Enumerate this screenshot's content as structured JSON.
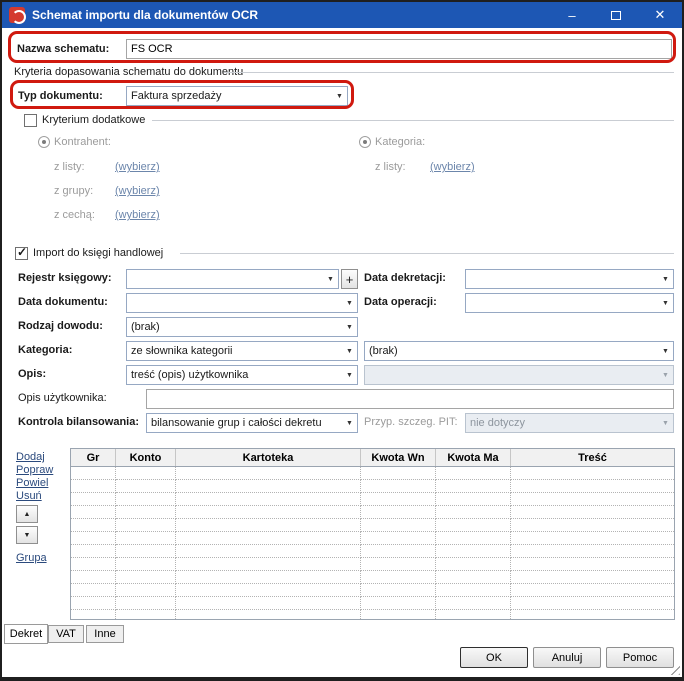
{
  "colors": {
    "titlebar": "#1d57b4",
    "annotation": "#d0190f",
    "link": "#2b4a7d"
  },
  "window": {
    "title": "Schemat importu dla dokumentów OCR",
    "minimize": "–",
    "close": "✕"
  },
  "schema": {
    "label": "Nazwa schematu:",
    "value": "FS OCR"
  },
  "criteria": {
    "title": "Kryteria dopasowania schematu do dokumentu",
    "doc_type_label": "Typ dokumentu:",
    "doc_type_value": "Faktura sprzedaży",
    "additional_label": "Kryterium dodatkowe",
    "kontrahent_label": "Kontrahent:",
    "kategoria_label": "Kategoria:",
    "z_listy": "z listy:",
    "z_grupy": "z grupy:",
    "z_cecha": "z cechą:",
    "wybierz": "(wybierz)"
  },
  "import": {
    "label": "Import do księgi handlowej",
    "rejestr_label": "Rejestr księgowy:",
    "rejestr_value": "",
    "add_button": "+",
    "data_dekretacji_label": "Data dekretacji:",
    "data_dekretacji_value": "",
    "data_dokumentu_label": "Data dokumentu:",
    "data_dokumentu_value": "",
    "data_operacji_label": "Data operacji:",
    "data_operacji_value": "",
    "rodzaj_label": "Rodzaj dowodu:",
    "rodzaj_value": "(brak)",
    "kategoria_label": "Kategoria:",
    "kategoria_value": "ze słownika kategorii",
    "kategoria_value2": "(brak)",
    "opis_label": "Opis:",
    "opis_value": "treść (opis) użytkownika",
    "opis_value2": "",
    "opis_uzytkownika_label": "Opis użytkownika:",
    "opis_uzytkownika_value": "",
    "kontrola_label": "Kontrola bilansowania:",
    "kontrola_value": "bilansowanie grup i całości dekretu",
    "pit_label": "Przyp. szczeg. PIT:",
    "pit_value": "nie dotyczy"
  },
  "grid": {
    "actions": [
      "Dodaj",
      "Popraw",
      "Powiel",
      "Usuń"
    ],
    "group_link": "Grupa",
    "columns": [
      "Gr",
      "Konto",
      "Kartoteka",
      "Kwota Wn",
      "Kwota Ma",
      "Treść"
    ]
  },
  "tabs": [
    "Dekret",
    "VAT",
    "Inne"
  ],
  "footer": {
    "ok": "OK",
    "cancel": "Anuluj",
    "help": "Pomoc"
  }
}
